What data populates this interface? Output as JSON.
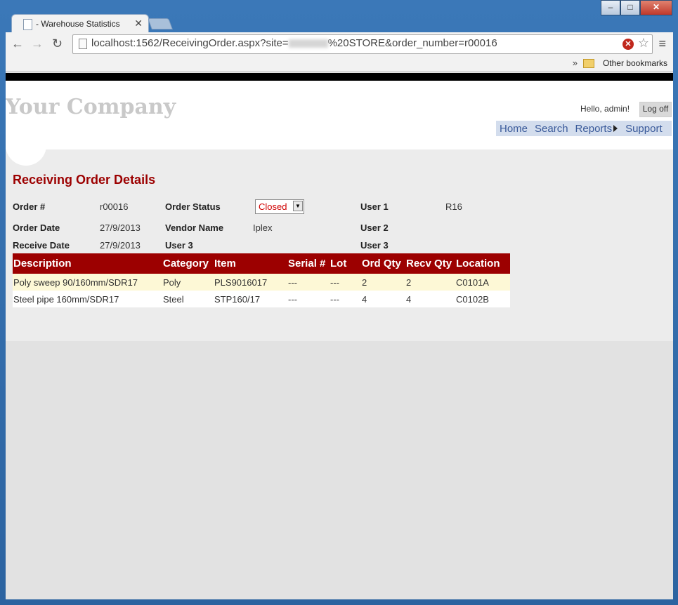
{
  "browser": {
    "tab_title": "- Warehouse Statistics",
    "url_prefix": "localhost:1562/ReceivingOrder.aspx?site=",
    "url_suffix": "%20STORE&order_number=r00016",
    "bookmarks_chevron": "»",
    "other_bookmarks": "Other bookmarks"
  },
  "header": {
    "logo": "Your Company",
    "greeting": "Hello, admin!",
    "logoff": "Log off",
    "nav": {
      "home": "Home",
      "search": "Search",
      "reports": "Reports",
      "support": "Support"
    }
  },
  "page": {
    "title": "Receiving Order Details",
    "fields": {
      "order_no_label": "Order #",
      "order_no": "r00016",
      "order_status_label": "Order Status",
      "order_status": "Closed",
      "user1_label": "User 1",
      "user1": "R16",
      "order_date_label": "Order Date",
      "order_date": "27/9/2013",
      "vendor_label": "Vendor Name",
      "vendor": "Iplex",
      "user2_label": "User 2",
      "receive_date_label": "Receive Date",
      "receive_date": "27/9/2013",
      "user3a_label": "User 3",
      "user3b_label": "User 3"
    }
  },
  "items_table": {
    "columns": [
      "Description",
      "Category",
      "Item",
      "Serial #",
      "Lot",
      "Ord Qty",
      "Recv Qty",
      "Location"
    ],
    "rows": [
      [
        "Poly sweep 90/160mm/SDR17",
        "Poly",
        "PLS9016017",
        "---",
        "---",
        "2",
        "2",
        "C0101A"
      ],
      [
        "Steel pipe 160mm/SDR17",
        "Steel",
        "STP160/17",
        "---",
        "---",
        "4",
        "4",
        "C0102B"
      ]
    ]
  },
  "colors": {
    "accent_dark_red": "#9c0000",
    "status_red": "#d00000",
    "row_highlight": "#fdf8d6",
    "nav_bg": "#d3dded",
    "nav_link": "#3a5a9a"
  }
}
